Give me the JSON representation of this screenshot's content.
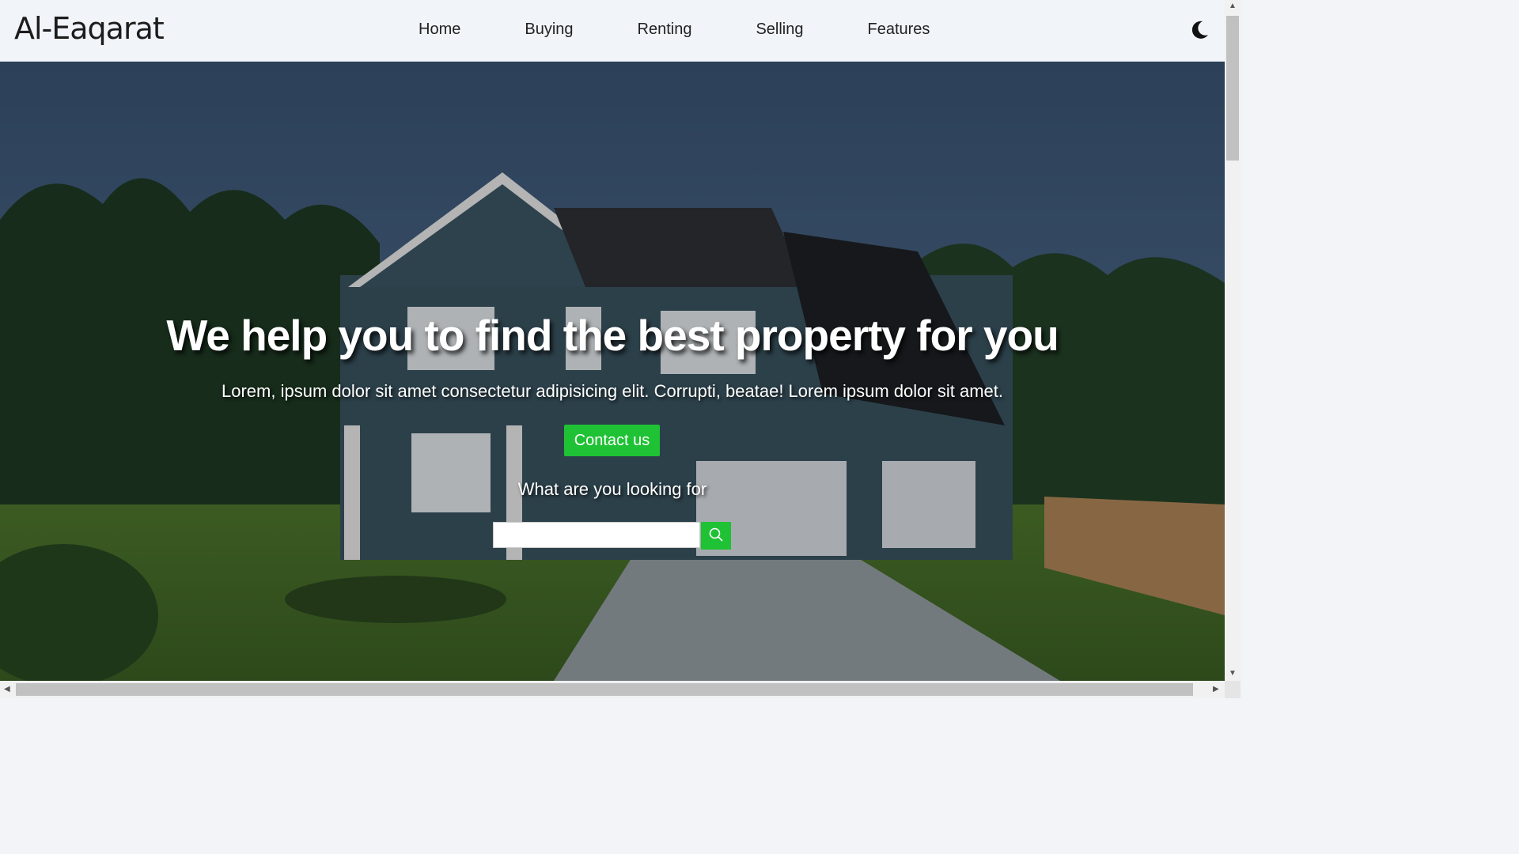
{
  "brand": "Al-Eaqarat",
  "nav": {
    "items": [
      {
        "label": "Home"
      },
      {
        "label": "Buying"
      },
      {
        "label": "Renting"
      },
      {
        "label": "Selling"
      },
      {
        "label": "Features"
      }
    ],
    "theme_toggle_icon": "moon-icon"
  },
  "hero": {
    "title": "We help you to find the best property for you",
    "subtitle": "Lorem, ipsum dolor sit amet consectetur adipisicing elit. Corrupti, beatae! Lorem ipsum dolor sit amet.",
    "contact_label": "Contact us",
    "search_label": "What are you looking for",
    "search_value": "",
    "search_icon": "search-icon"
  },
  "colors": {
    "accent": "#1fc234",
    "navbar_bg": "#f1f4f8"
  }
}
